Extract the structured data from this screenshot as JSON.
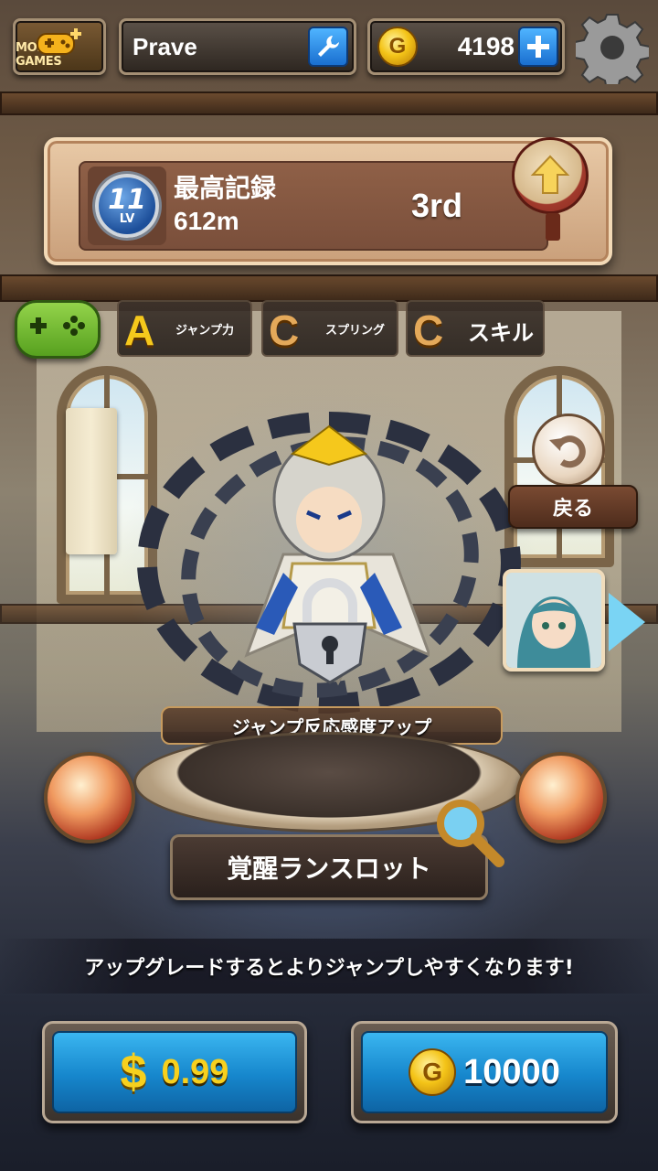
{
  "topbar": {
    "more_games_label": "MORE GAMES",
    "player_name": "Prave",
    "coins": "4198"
  },
  "record": {
    "level": "11",
    "level_label": "LV",
    "best_record_label": "最高記録",
    "distance": "612m",
    "rank": "3rd"
  },
  "stats": [
    {
      "grade": "A",
      "label": "ジャンプ力"
    },
    {
      "grade": "C",
      "label": "スプリング"
    },
    {
      "grade": "C",
      "label": "スキル"
    }
  ],
  "side": {
    "back_label": "戻る"
  },
  "character": {
    "perk": "ジャンプ反応感度アップ",
    "name": "覚醒ランスロット",
    "description": "アップグレードするとよりジャンプしやすくなります!"
  },
  "purchase": {
    "currency_symbol": "$",
    "price": "0.99",
    "coin_cost": "10000"
  },
  "colors": {
    "grade_a": "#f5c81c",
    "grade_c": "#e4a95a",
    "button_blue": "#1686cc",
    "gold": "#f7d01e"
  },
  "icons": [
    "gamepad-plus-icon",
    "wrench-icon",
    "coin-icon",
    "plus-icon",
    "gear-icon",
    "level-badge-icon",
    "up-arrow-icon",
    "gamepad-icon",
    "undo-icon",
    "lock-icon",
    "magnifier-icon",
    "next-arrow-icon"
  ]
}
